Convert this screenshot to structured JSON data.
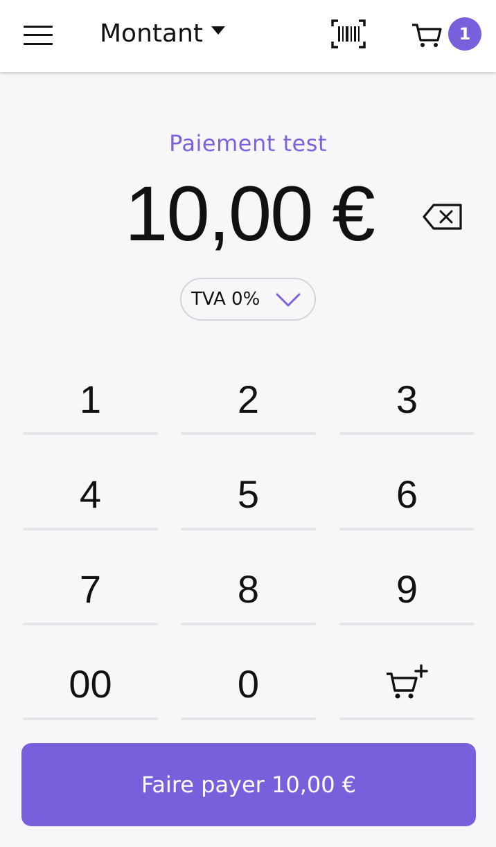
{
  "header": {
    "menu_icon": "hamburger-menu-icon",
    "title": "Montant",
    "scan_icon": "barcode-scan-icon",
    "cart_icon": "shopping-cart-icon",
    "cart_count": "1"
  },
  "payment": {
    "label": "Paiement test",
    "amount": "10,00 €",
    "backspace_icon": "backspace-icon"
  },
  "vat": {
    "label": "TVA 0%",
    "chevron_icon": "chevron-down-icon"
  },
  "keypad": {
    "keys": [
      "1",
      "2",
      "3",
      "4",
      "5",
      "6",
      "7",
      "8",
      "9",
      "00",
      "0"
    ],
    "add_to_cart_icon": "cart-add-icon"
  },
  "action": {
    "pay_label": "Faire payer 10,00 €"
  },
  "colors": {
    "accent": "#7860dc",
    "background": "#f7f7fa"
  }
}
